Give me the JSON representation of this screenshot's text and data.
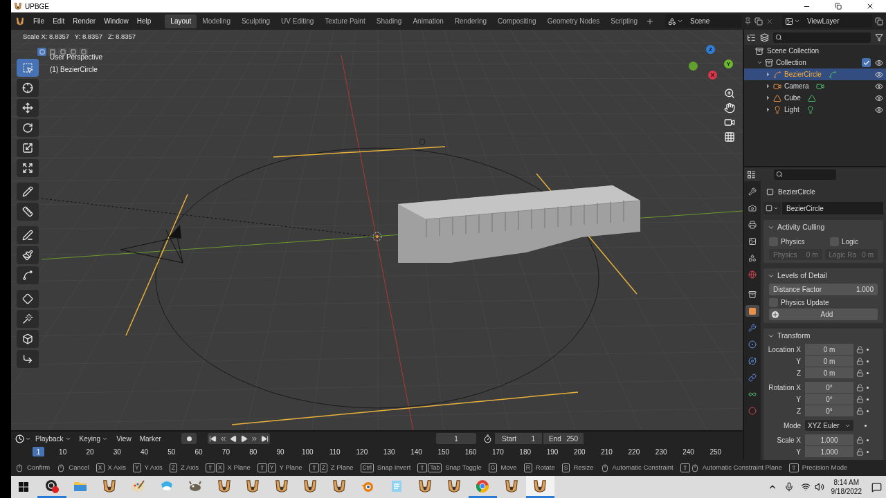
{
  "window": {
    "title": "UPBGE"
  },
  "menu": [
    "File",
    "Edit",
    "Render",
    "Window",
    "Help"
  ],
  "workspaces": [
    {
      "label": "Layout",
      "selected": true
    },
    {
      "label": "Modeling",
      "selected": false
    },
    {
      "label": "Sculpting",
      "selected": false
    },
    {
      "label": "UV Editing",
      "selected": false
    },
    {
      "label": "Texture Paint",
      "selected": false
    },
    {
      "label": "Shading",
      "selected": false
    },
    {
      "label": "Animation",
      "selected": false
    },
    {
      "label": "Rendering",
      "selected": false
    },
    {
      "label": "Compositing",
      "selected": false
    },
    {
      "label": "Geometry Nodes",
      "selected": false
    },
    {
      "label": "Scripting",
      "selected": false
    }
  ],
  "scene": "Scene",
  "view_layer": "ViewLayer",
  "viewport": {
    "header": "Scale X: 8.8357   Y: 8.8357   Z: 8.8357",
    "perspective": "User Perspective",
    "object": "(1) BezierCircle",
    "select_modes": [
      {
        "selected": true
      },
      {
        "selected": false
      },
      {
        "selected": false
      },
      {
        "selected": false
      },
      {
        "selected": false
      }
    ],
    "tools": [
      {
        "kind": "select",
        "selected": true
      },
      {
        "kind": "cursor",
        "selected": false
      },
      {
        "kind": "move",
        "selected": false
      },
      {
        "kind": "rotate",
        "selected": false
      },
      {
        "kind": "scale",
        "selected": false
      },
      {
        "kind": "transform",
        "selected": false
      },
      {
        "kind": "annotate",
        "selected": false
      },
      {
        "kind": "measure",
        "selected": false
      },
      {
        "kind": "draw",
        "selected": false
      },
      {
        "kind": "pen",
        "selected": false
      },
      {
        "kind": "curve",
        "selected": false
      },
      {
        "kind": "radius",
        "selected": false
      },
      {
        "kind": "tilt",
        "selected": false
      },
      {
        "kind": "extrude",
        "selected": false
      },
      {
        "kind": "randomize",
        "selected": false
      }
    ],
    "gizmo_axes": [
      "Z",
      "Y",
      "X"
    ]
  },
  "outliner": {
    "root": "Scene Collection",
    "items": [
      {
        "label": "Collection",
        "kind": "collection",
        "checked": true,
        "expanded": true,
        "selected": false,
        "children": [
          {
            "label": "BezierCircle",
            "kind": "curve",
            "selected": true,
            "expanded": false
          },
          {
            "label": "Camera",
            "kind": "camera",
            "selected": false,
            "expanded": false
          },
          {
            "label": "Cube",
            "kind": "mesh",
            "selected": false,
            "expanded": false
          },
          {
            "label": "Light",
            "kind": "light",
            "selected": false,
            "expanded": false
          }
        ]
      }
    ]
  },
  "properties": {
    "tabs": [
      {
        "kind": "tool",
        "selected": false
      },
      {
        "kind": "render",
        "selected": false
      },
      {
        "kind": "output",
        "selected": false
      },
      {
        "kind": "view_layer",
        "selected": false
      },
      {
        "kind": "scene",
        "selected": false
      },
      {
        "kind": "world",
        "selected": false
      },
      {
        "kind": "collection",
        "selected": false
      },
      {
        "kind": "object",
        "selected": true
      },
      {
        "kind": "modifiers",
        "selected": false
      },
      {
        "kind": "particles",
        "selected": false
      },
      {
        "kind": "physics",
        "selected": false
      },
      {
        "kind": "constraints",
        "selected": false
      },
      {
        "kind": "data",
        "selected": false
      },
      {
        "kind": "material",
        "selected": false
      }
    ],
    "object_name": "BezierCircle",
    "object_field": "BezierCircle",
    "culling": {
      "title": "Activity Culling",
      "expanded": true,
      "physics": {
        "label": "Physics",
        "checked": false
      },
      "logic": {
        "label": "Logic",
        "checked": false
      },
      "physics_radius": {
        "label": "Physics",
        "value": "0 m",
        "disabled": true
      },
      "logic_radius": {
        "label": "Logic Ra",
        "value": "0 m",
        "disabled": true
      }
    },
    "lod": {
      "title": "Levels of Detail",
      "expanded": true,
      "distance_factor": {
        "label": "Distance Factor",
        "value": "1.000"
      },
      "physics_update": {
        "label": "Physics Update",
        "checked": false
      },
      "add": "Add"
    },
    "transform": {
      "title": "Transform",
      "expanded": true,
      "rows": [
        {
          "kind": "field",
          "label": "Location X",
          "value": "0 m"
        },
        {
          "kind": "field",
          "label": "Y",
          "value": "0 m"
        },
        {
          "kind": "field",
          "label": "Z",
          "value": "0 m"
        },
        {
          "kind": "field",
          "label": "Rotation X",
          "value": "0°"
        },
        {
          "kind": "field",
          "label": "Y",
          "value": "0°"
        },
        {
          "kind": "field",
          "label": "Z",
          "value": "0°"
        },
        {
          "kind": "select",
          "label": "Mode",
          "value": "XYZ Euler"
        },
        {
          "kind": "field",
          "label": "Scale X",
          "value": "1.000"
        },
        {
          "kind": "field",
          "label": "Y",
          "value": "1.000"
        }
      ]
    }
  },
  "timeline": {
    "menus": [
      {
        "label": "Playback",
        "dropdown": true
      },
      {
        "label": "Keying",
        "dropdown": true
      },
      {
        "label": "View",
        "dropdown": false
      },
      {
        "label": "Marker",
        "dropdown": false
      }
    ],
    "current_frame": "1",
    "start_label": "Start",
    "start": "1",
    "end_label": "End",
    "end": "250",
    "ruler": [
      "1",
      "10",
      "20",
      "30",
      "40",
      "50",
      "60",
      "70",
      "80",
      "90",
      "100",
      "110",
      "120",
      "130",
      "140",
      "150",
      "160",
      "170",
      "180",
      "190",
      "200",
      "210",
      "220",
      "230",
      "240",
      "250"
    ]
  },
  "status_bar": [
    {
      "keys": [
        {
          "kind": "mouse"
        }
      ],
      "label": "Confirm"
    },
    {
      "keys": [
        {
          "kind": "mouse"
        }
      ],
      "label": "Cancel"
    },
    {
      "keys": [
        {
          "kind": "key",
          "text": "X"
        }
      ],
      "label": "X Axis"
    },
    {
      "keys": [
        {
          "kind": "key",
          "text": "Y"
        }
      ],
      "label": "Y Axis"
    },
    {
      "keys": [
        {
          "kind": "key",
          "text": "Z"
        }
      ],
      "label": "Z Axis"
    },
    {
      "keys": [
        {
          "kind": "key",
          "text": "⇧"
        },
        {
          "kind": "key",
          "text": "X"
        }
      ],
      "label": "X Plane"
    },
    {
      "keys": [
        {
          "kind": "key",
          "text": "⇧"
        },
        {
          "kind": "key",
          "text": "Y"
        }
      ],
      "label": "Y Plane"
    },
    {
      "keys": [
        {
          "kind": "key",
          "text": "⇧"
        },
        {
          "kind": "key",
          "text": "Z"
        }
      ],
      "label": "Z Plane"
    },
    {
      "keys": [
        {
          "kind": "key",
          "text": "Ctrl"
        }
      ],
      "label": "Snap Invert"
    },
    {
      "keys": [
        {
          "kind": "key",
          "text": "⇧"
        },
        {
          "kind": "key",
          "text": "Tab"
        }
      ],
      "label": "Snap Toggle"
    },
    {
      "keys": [
        {
          "kind": "key",
          "text": "G"
        }
      ],
      "label": "Move"
    },
    {
      "keys": [
        {
          "kind": "key",
          "text": "R"
        }
      ],
      "label": "Rotate"
    },
    {
      "keys": [
        {
          "kind": "key",
          "text": "S"
        }
      ],
      "label": "Resize"
    },
    {
      "keys": [
        {
          "kind": "mouse"
        }
      ],
      "label": "Automatic Constraint"
    },
    {
      "keys": [
        {
          "kind": "key",
          "text": "⇧"
        },
        {
          "kind": "mouse"
        }
      ],
      "label": "Automatic Constraint Plane"
    },
    {
      "keys": [
        {
          "kind": "key",
          "text": "⇧"
        }
      ],
      "label": "Precision Mode"
    }
  ],
  "taskbar": {
    "apps": [
      {
        "kind": "obs",
        "running": true,
        "selected": false
      },
      {
        "kind": "folder",
        "running": false,
        "selected": false
      },
      {
        "kind": "upbge",
        "running": false,
        "selected": false
      },
      {
        "kind": "paint",
        "running": false,
        "selected": false
      },
      {
        "kind": "paint3d",
        "running": false,
        "selected": false
      },
      {
        "kind": "gimp",
        "running": false,
        "selected": false
      },
      {
        "kind": "upbge",
        "running": false,
        "selected": false
      },
      {
        "kind": "upbge",
        "running": false,
        "selected": false
      },
      {
        "kind": "upbge",
        "running": false,
        "selected": false
      },
      {
        "kind": "upbge",
        "running": false,
        "selected": false
      },
      {
        "kind": "upbge",
        "running": false,
        "selected": false
      },
      {
        "kind": "blender",
        "running": false,
        "selected": false
      },
      {
        "kind": "notepad",
        "running": false,
        "selected": false
      },
      {
        "kind": "upbge",
        "running": false,
        "selected": false
      },
      {
        "kind": "upbge",
        "running": false,
        "selected": false
      },
      {
        "kind": "chrome",
        "running": true,
        "selected": false
      },
      {
        "kind": "upbge",
        "running": false,
        "selected": false
      },
      {
        "kind": "upbge",
        "running": true,
        "selected": true
      }
    ],
    "time": "8:14 AM",
    "date": "9/18/2022"
  }
}
